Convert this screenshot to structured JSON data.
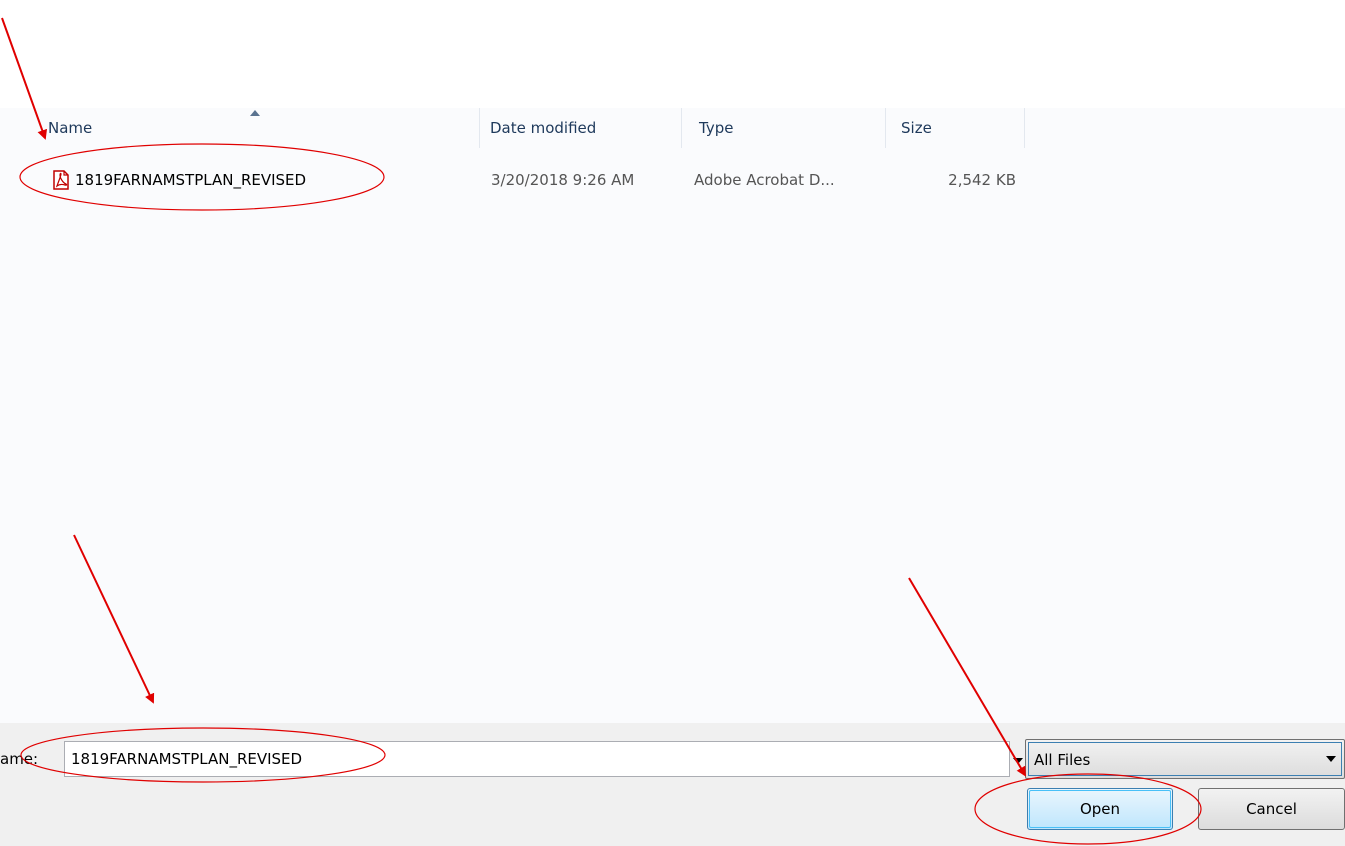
{
  "columns": {
    "name": "Name",
    "date_modified": "Date modified",
    "type": "Type",
    "size": "Size"
  },
  "files": [
    {
      "name": "1819FARNAMSTPLAN_REVISED",
      "date_modified": "3/20/2018 9:26 AM",
      "type": "Adobe Acrobat D...",
      "size": "2,542 KB",
      "icon": "pdf-file-icon"
    }
  ],
  "footer": {
    "file_name_label": "ame:",
    "file_name_value": "1819FARNAMSTPLAN_REVISED",
    "file_type_filter": "All Files",
    "open_label": "Open",
    "cancel_label": "Cancel"
  },
  "colors": {
    "annotation": "#e00000",
    "header_text": "#1e395b",
    "pdf_icon": "#c00000"
  },
  "icons": {
    "sort": "sort-ascending-icon",
    "dropdown": "chevron-down-icon"
  }
}
